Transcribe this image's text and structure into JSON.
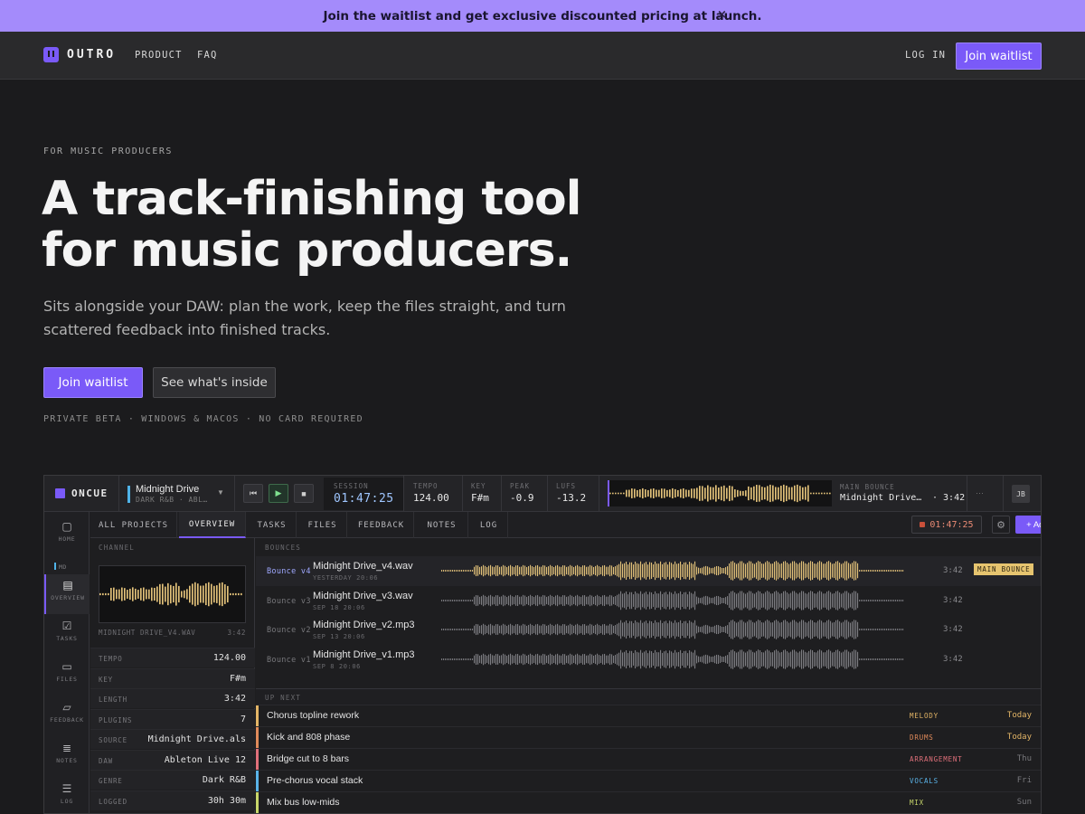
{
  "announcement": {
    "text": "Join the waitlist and get exclusive discounted pricing at launch.",
    "close": "×"
  },
  "nav": {
    "brand": "OUTRO",
    "links": [
      "PRODUCT",
      "FAQ"
    ],
    "login": "LOG IN",
    "cta": "Join waitlist"
  },
  "hero": {
    "eyebrow": "FOR MUSIC PRODUCERS",
    "headline_line1": "A track-finishing tool",
    "headline_line2": "for music producers.",
    "subtitle": "Sits alongside your DAW: plan the work, keep the files straight, and turn scattered feedback into finished tracks.",
    "primary_cta": "Join waitlist",
    "secondary_cta": "See what's inside",
    "footnote": "PRIVATE BETA · WINDOWS & MACOS · NO CARD REQUIRED"
  },
  "app": {
    "brand": "ONCUE",
    "project": {
      "name": "Midnight Drive",
      "meta": "DARK R&B · ABL…"
    },
    "transport": {
      "prev": "⏮",
      "play": "▶",
      "stop": "■"
    },
    "stats": {
      "session_label": "SESSION",
      "session_value": "01:47:25",
      "tempo_label": "TEMPO",
      "tempo_value": "124.00",
      "key_label": "KEY",
      "key_value": "F#m",
      "peak_label": "PEAK",
      "peak_value": "-0.9",
      "lufs_label": "LUFS",
      "lufs_value": "-13.2"
    },
    "main_bounce": {
      "label": "MAIN BOUNCE",
      "name": "Midnight Drive…",
      "duration": "· 3:42"
    },
    "more": "···",
    "avatar": "JB",
    "sidebar": [
      {
        "label": "HOME",
        "icon": "home-icon"
      },
      {
        "label": "OVERVIEW",
        "icon": "overview-icon"
      },
      {
        "label": "TASKS",
        "icon": "tasks-icon"
      },
      {
        "label": "FILES",
        "icon": "folder-icon"
      },
      {
        "label": "FEEDBACK",
        "icon": "feedback-icon"
      },
      {
        "label": "NOTES",
        "icon": "notes-icon"
      },
      {
        "label": "LOG",
        "icon": "log-icon"
      }
    ],
    "sidebar_project_tag": "MD",
    "tabs": [
      "ALL PROJECTS",
      "OVERVIEW",
      "TASKS",
      "FILES",
      "FEEDBACK",
      "NOTES",
      "LOG"
    ],
    "active_tab": "OVERVIEW",
    "timer": "01:47:25",
    "add_task": "+ Add task",
    "channel": {
      "section": "CHANNEL",
      "file": "MIDNIGHT DRIVE_V4.WAV",
      "file_duration": "3:42",
      "rows": [
        {
          "k": "TEMPO",
          "v": "124.00"
        },
        {
          "k": "KEY",
          "v": "F#m"
        },
        {
          "k": "LENGTH",
          "v": "3:42"
        },
        {
          "k": "PLUGINS",
          "v": "7"
        },
        {
          "k": "SOURCE",
          "v": "Midnight Drive.als"
        },
        {
          "k": "DAW",
          "v": "Ableton Live 12"
        },
        {
          "k": "GENRE",
          "v": "Dark R&B"
        },
        {
          "k": "LOGGED",
          "v": "30h 30m"
        }
      ]
    },
    "bounces_section": "BOUNCES",
    "bounces": [
      {
        "label": "Bounce v4",
        "file": "Midnight Drive_v4.wav",
        "date": "YESTERDAY 20:06",
        "duration": "3:42",
        "badge": "MAIN BOUNCE",
        "color": "#e3c27a"
      },
      {
        "label": "Bounce v3",
        "file": "Midnight Drive_v3.wav",
        "date": "SEP 18 20:06",
        "duration": "3:42",
        "badge": "",
        "color": "#7d7d82"
      },
      {
        "label": "Bounce v2",
        "file": "Midnight Drive_v2.mp3",
        "date": "SEP 13 20:06",
        "duration": "3:42",
        "badge": "",
        "color": "#7d7d82"
      },
      {
        "label": "Bounce v1",
        "file": "Midnight Drive_v1.mp3",
        "date": "SEP 8 20:06",
        "duration": "3:42",
        "badge": "",
        "color": "#7d7d82"
      }
    ],
    "upnext_section": "UP NEXT",
    "tasks": [
      {
        "name": "Chorus topline rework",
        "category": "MELODY",
        "cat_color": "#e3b566",
        "when": "Today",
        "when_color": "#e3b566",
        "bar": "#e3b566"
      },
      {
        "name": "Kick and 808 phase",
        "category": "DRUMS",
        "cat_color": "#e08a5a",
        "when": "Today",
        "when_color": "#e3b566",
        "bar": "#e08a5a"
      },
      {
        "name": "Bridge cut to 8 bars",
        "category": "ARRANGEMENT",
        "cat_color": "#e0707a",
        "when": "Thu",
        "when_color": "#77777b",
        "bar": "#e0707a"
      },
      {
        "name": "Pre-chorus vocal stack",
        "category": "VOCALS",
        "cat_color": "#5ab3e8",
        "when": "Fri",
        "when_color": "#77777b",
        "bar": "#5ab3e8"
      },
      {
        "name": "Mix bus low-mids",
        "category": "MIX",
        "cat_color": "#c7d66a",
        "when": "Sun",
        "when_color": "#77777b",
        "bar": "#c7d66a"
      }
    ]
  }
}
